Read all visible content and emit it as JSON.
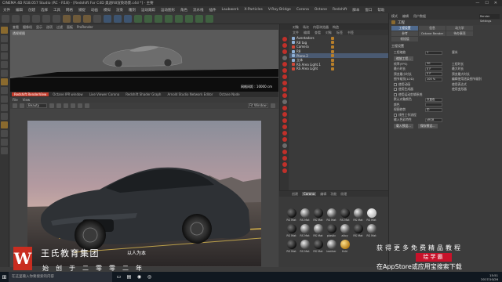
{
  "window": {
    "title": "CINEMA 4D R18.057 Studio (RC - R18) - [Redshift For C4D 奥迪R8渲染场景.c4d *] - 主要",
    "controls": [
      "—",
      "☐",
      "✕"
    ]
  },
  "menubar": [
    "文件",
    "编辑",
    "创建",
    "选择",
    "工具",
    "网格",
    "捕捉",
    "动画",
    "模拟",
    "渲染",
    "雕刻",
    "运动跟踪",
    "运动图形",
    "角色",
    "流水线",
    "插件",
    "Laubwerk",
    "X-Particles",
    "V-Ray Bridge",
    "Corona",
    "Octane",
    "Redshift",
    "脚本",
    "窗口",
    "帮助"
  ],
  "toolbar": {
    "icons": [
      "undo-icon",
      "redo-icon",
      "select-icon",
      "move-icon",
      "scale-icon",
      "rotate-icon",
      "x-axis-icon",
      "y-axis-icon",
      "z-axis-icon",
      "coordinate-icon",
      "render-region-icon",
      "render-view-icon",
      "render-settings-icon",
      "cube-icon",
      "pen-icon",
      "subdivide-icon",
      "array-icon",
      "deformer-icon",
      "floor-icon",
      "camera-icon",
      "light-icon"
    ]
  },
  "viewport": {
    "menu": [
      "查看",
      "摄像机",
      "显示",
      "选项",
      "过滤",
      "面板",
      "ProRender"
    ],
    "label": "透视视图",
    "distance": "网格间距 : 10000 cm"
  },
  "renderview": {
    "tabs": [
      {
        "label": "Redshift RenderView",
        "active": true
      },
      {
        "label": "Octane IPR window",
        "active": false
      },
      {
        "label": "Live Viewer Corona",
        "active": false
      },
      {
        "label": "Redshift Shader Graph",
        "active": false
      },
      {
        "label": "Arnold Studio Network Editor",
        "active": false
      },
      {
        "label": "Octane Node",
        "active": false
      }
    ],
    "menu": [
      "File",
      "View"
    ],
    "beauty_select": "Beauty",
    "fit_window": "Fit Window"
  },
  "objects": {
    "header": [
      "对象",
      "场次",
      "内容浏览器",
      "构造"
    ],
    "menu": [
      "文件",
      "编辑",
      "查看",
      "对象",
      "标签",
      "书签"
    ],
    "items": [
      {
        "label": "Aventadors",
        "icon": "null"
      },
      {
        "label": "R8 tag",
        "icon": "null"
      },
      {
        "label": "Camera",
        "icon": "camera"
      },
      {
        "label": "R8",
        "icon": "null"
      },
      {
        "label": "Plane.2",
        "icon": "plane"
      },
      {
        "label": "立体",
        "icon": "null"
      },
      {
        "label": "RS Area Light.1",
        "icon": "light"
      },
      {
        "label": "RS Area Light",
        "icon": "light"
      }
    ]
  },
  "materials": {
    "menu": [
      "创建",
      "Corona",
      "编辑",
      "功能",
      "纹理"
    ],
    "items": [
      {
        "name": "RS Mat",
        "style": "dk"
      },
      {
        "name": "RS Mat",
        "style": "gl"
      },
      {
        "name": "RS Mat",
        "style": "dk"
      },
      {
        "name": "RS Mat",
        "style": "gl"
      },
      {
        "name": "RS Mat",
        "style": "dk"
      },
      {
        "name": "RS Mat",
        "style": "gl"
      },
      {
        "name": "RS Mat",
        "style": "w"
      },
      {
        "name": "RS Mat",
        "style": "dk"
      },
      {
        "name": "RS Mat",
        "style": "gl"
      },
      {
        "name": "RS Mat",
        "style": "gl"
      },
      {
        "name": "plastic",
        "style": "dk"
      },
      {
        "name": "alloy",
        "style": "gl"
      },
      {
        "name": "RS Mat",
        "style": "dk"
      },
      {
        "name": "RS Mat",
        "style": "gl"
      },
      {
        "name": "RS Mat",
        "style": "dk"
      },
      {
        "name": "RS Mat",
        "style": "gl"
      },
      {
        "name": "RS Mat",
        "style": "dk"
      },
      {
        "name": "leather",
        "style": "gl"
      },
      {
        "name": "Hdri",
        "style": "gold"
      }
    ]
  },
  "attributes": {
    "menu": [
      "模式",
      "编辑",
      "用户数据"
    ],
    "selector": "Render Settings",
    "title": "工程",
    "tabs": [
      {
        "label": "工程设置",
        "active": true
      },
      {
        "label": "信息",
        "active": false
      },
      {
        "label": "动力学",
        "active": false
      },
      {
        "label": "参考",
        "active": false
      },
      {
        "label": "Octane Render",
        "active": false
      },
      {
        "label": "待办事项",
        "active": false
      },
      {
        "label": "帧插值",
        "active": false
      }
    ],
    "section": "工程设置",
    "rows": [
      {
        "label": "工程缩放",
        "value": "1",
        "right": "厘米"
      },
      {
        "label": "缩放工程...",
        "button": true
      },
      {
        "label": "帧率(FPS)",
        "value": "30",
        "right": "工程时长"
      },
      {
        "label": "最小时长",
        "value": "0 F",
        "right": "最大时长"
      },
      {
        "label": "预览最小时长",
        "value": "0 F",
        "right": "预览最大时长"
      },
      {
        "label": "细节级别(LOD)",
        "value": "100 %",
        "right": "编辑使用渲染细节级别"
      },
      {
        "label": "使用动画",
        "check": true,
        "right": "使用表达式"
      },
      {
        "label": "使用生成器",
        "check": true,
        "right": "使用变形器"
      },
      {
        "label": "使用运动剪辑系统",
        "check": true
      },
      {
        "label": "默认对象颜色",
        "value": "灰蓝色"
      },
      {
        "label": "颜色",
        "value": ""
      },
      {
        "label": "视图修剪",
        "value": "中"
      },
      {
        "label": "线性工作流程",
        "check": true
      },
      {
        "label": "输入色彩特性",
        "value": "sRGB"
      },
      {
        "label": "载入预设...",
        "button": true,
        "right": "保存预设..."
      }
    ]
  },
  "brand": {
    "name": "王氏教育集团",
    "slogan": "以人为本",
    "sub": "始创于二零零二年"
  },
  "promo": {
    "line1": "获得更多免费精品教程",
    "badge": "绘学霸",
    "line2": "在AppStore或应用宝搜索下载"
  },
  "taskbar": {
    "search": "在这里输入你要搜索的内容",
    "time": "15:51",
    "date": "2017/10/26"
  }
}
